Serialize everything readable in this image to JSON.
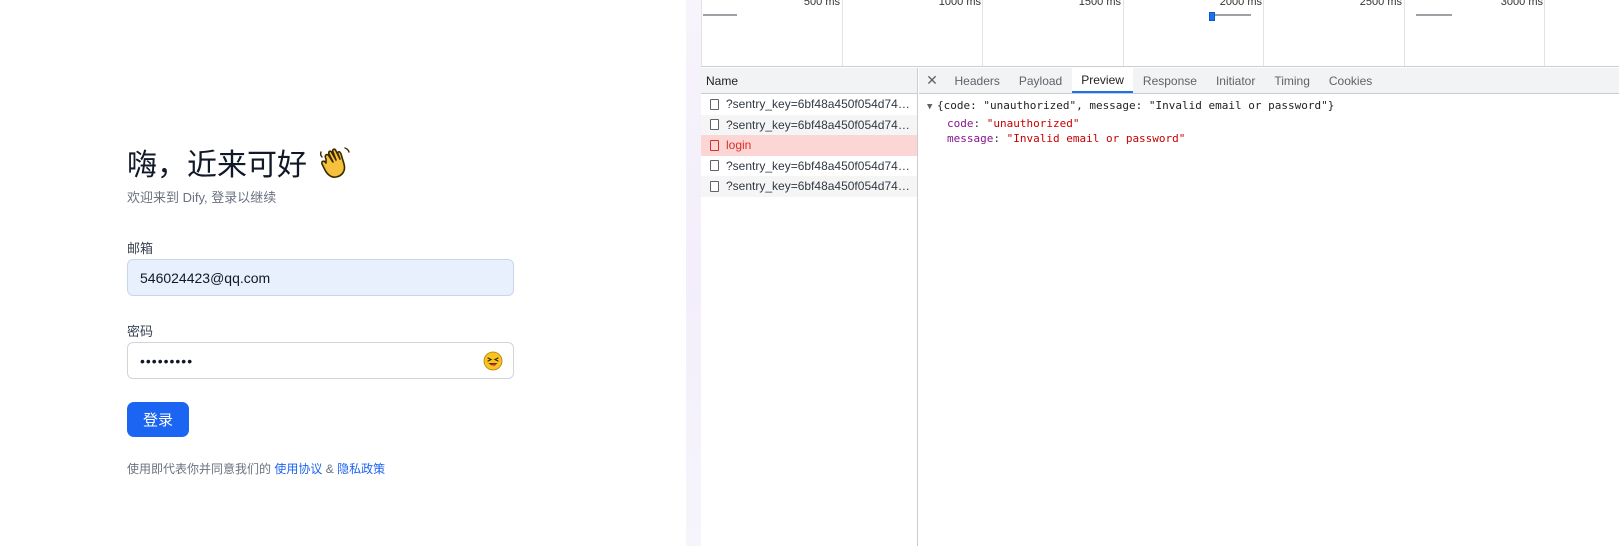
{
  "login": {
    "greeting": "嗨，近来可好",
    "subtitle": "欢迎来到 Dify, 登录以继续",
    "email_label": "邮箱",
    "email_value": "546024423@qq.com",
    "password_label": "密码",
    "password_value": "•••••••••",
    "login_button": "登录",
    "agreement_prefix": "使用即代表你并同意我们的",
    "terms_link": "使用协议",
    "and_text": "&",
    "privacy_link": "隐私政策",
    "accent_color": "#1c64f2"
  },
  "devtools": {
    "timeline": {
      "ticks": [
        "500 ms",
        "1000 ms",
        "1500 ms",
        "2000 ms",
        "2500 ms",
        "3000 ms"
      ]
    },
    "name_panel": {
      "header": "Name",
      "requests": [
        {
          "name": "?sentry_key=6bf48a450f054d7493...",
          "status": "ok"
        },
        {
          "name": "?sentry_key=6bf48a450f054d7493...",
          "status": "ok"
        },
        {
          "name": "login",
          "status": "error"
        },
        {
          "name": "?sentry_key=6bf48a450f054d7493...",
          "status": "ok"
        },
        {
          "name": "?sentry_key=6bf48a450f054d7493...",
          "status": "ok"
        }
      ]
    },
    "tabs": [
      "Headers",
      "Payload",
      "Preview",
      "Response",
      "Initiator",
      "Timing",
      "Cookies"
    ],
    "active_tab": "Preview",
    "preview": {
      "summary": "{code: \"unauthorized\", message: \"Invalid email or password\"}",
      "code_key": "code",
      "code_value": "\"unauthorized\"",
      "message_key": "message",
      "message_value": "\"Invalid email or password\""
    }
  }
}
